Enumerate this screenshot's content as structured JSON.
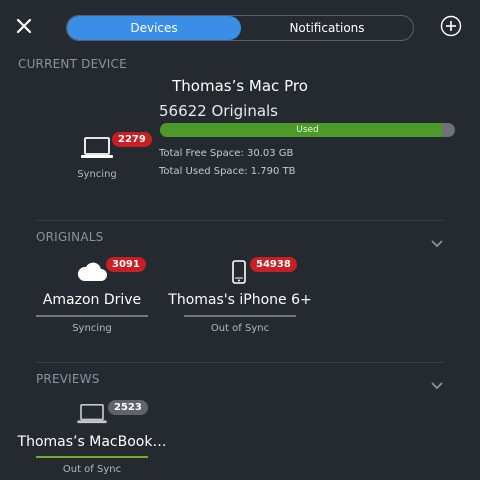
{
  "header": {
    "tabs": [
      {
        "label": "Devices",
        "active": true
      },
      {
        "label": "Notifications",
        "active": false
      }
    ]
  },
  "current_device": {
    "section_label": "CURRENT DEVICE",
    "name": "Thomas’s Mac Pro",
    "originals": "56622 Originals",
    "badge": "2279",
    "status": "Syncing",
    "storage_bar_label": "Used",
    "used_fraction": 0.955,
    "free_space": "Total Free Space: 30.03 GB",
    "used_space": "Total Used Space: 1.790 TB",
    "icon": "laptop-icon"
  },
  "originals": {
    "section_label": "ORIGINALS",
    "devices": [
      {
        "name": "Amazon Drive",
        "badge": "3091",
        "status": "Syncing",
        "icon": "cloud-icon"
      },
      {
        "name": "Thomas's iPhone 6+",
        "badge": "54938",
        "status": "Out of Sync",
        "icon": "phone-icon"
      }
    ]
  },
  "previews": {
    "section_label": "PREVIEWS",
    "devices": [
      {
        "name": "Thomas’s MacBook…",
        "badge": "2523",
        "status": "Out of Sync",
        "icon": "laptop-icon"
      }
    ]
  },
  "colors": {
    "background": "#252a31",
    "accent": "#3a8ee6",
    "badge_red": "#c81e24",
    "bar_green": "#4b9a2a"
  }
}
